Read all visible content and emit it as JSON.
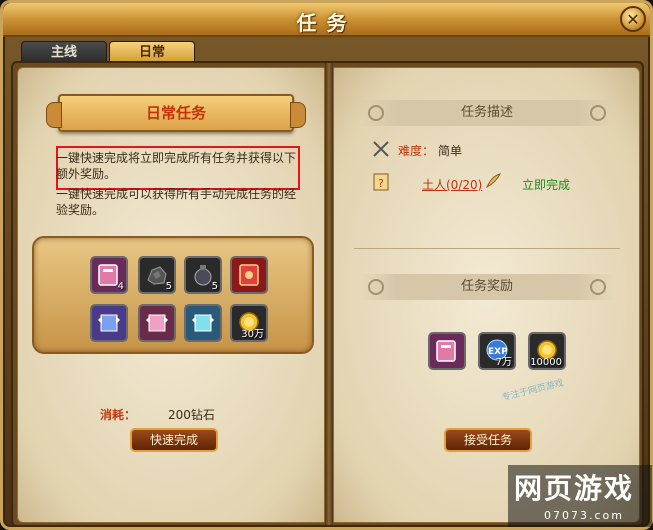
{
  "window": {
    "title": "任务",
    "close_label": "✕"
  },
  "tabs": [
    {
      "label": "主线",
      "active": false
    },
    {
      "label": "日常",
      "active": true
    }
  ],
  "left_page": {
    "banner": "日常任务",
    "desc_highlight": "一键快速完成将立即完成所有任务并获得以下额外奖励。",
    "desc_second": "一键快速完成可以获得所有手动完成任务的经验奖励。",
    "rewards": [
      {
        "icon": "book-icon",
        "count": "4"
      },
      {
        "icon": "ore-icon",
        "count": "5"
      },
      {
        "icon": "potion-bag-icon",
        "count": "5"
      },
      {
        "icon": "red-card-icon",
        "count": ""
      },
      {
        "icon": "blue-scroll-icon",
        "count": ""
      },
      {
        "icon": "pink-scroll-icon",
        "count": ""
      },
      {
        "icon": "cyan-scroll-icon",
        "count": ""
      },
      {
        "icon": "gold-coin-icon",
        "count": "30万"
      }
    ],
    "cost_label": "消耗：",
    "cost_value": "200钻石",
    "quick_button": "快速完成"
  },
  "right_page": {
    "desc_header": "任务描述",
    "difficulty_label": "难度：",
    "difficulty_value": "简单",
    "task_target": "土人(0/20)",
    "task_action": "立即完成",
    "reward_header": "任务奖励",
    "rewards": [
      {
        "icon": "book-icon",
        "count": ""
      },
      {
        "icon": "exp-icon",
        "count": "7万"
      },
      {
        "icon": "gold-coin-icon",
        "count": "10000"
      }
    ],
    "accept_button": "接受任务"
  },
  "watermark": {
    "line1": "专注于网页游戏",
    "brand": "网页游戏",
    "site": "07073.com"
  },
  "colors": {
    "accent": "#c4320a",
    "highlight_border": "#e3141c",
    "done_green": "#1c8a1c"
  }
}
